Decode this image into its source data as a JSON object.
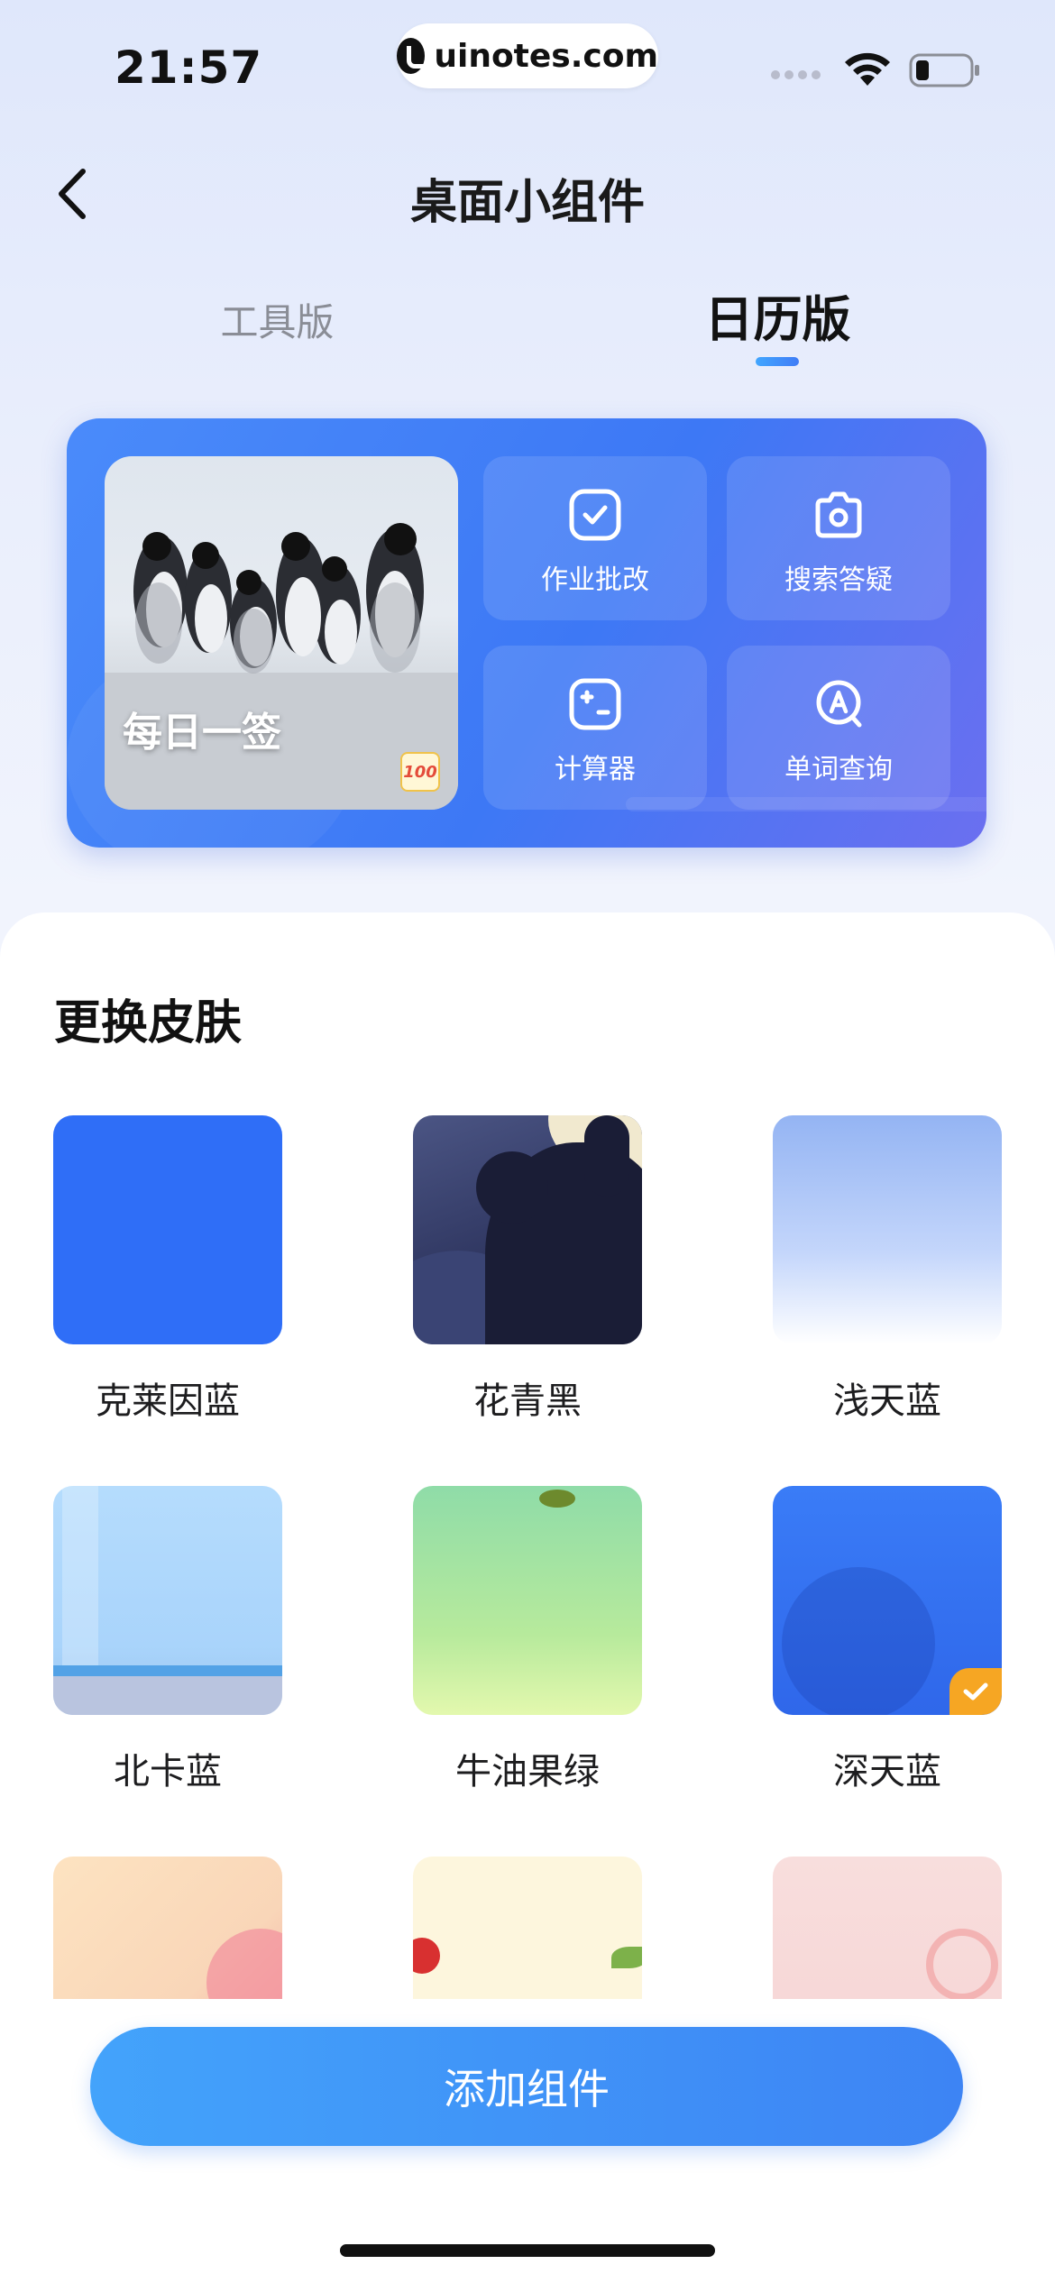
{
  "status_bar": {
    "time": "21:57",
    "url": "uinotes.com"
  },
  "nav": {
    "title": "桌面小组件"
  },
  "tabs": [
    {
      "label": "工具版",
      "active": false
    },
    {
      "label": "日历版",
      "active": true
    }
  ],
  "widget": {
    "daily_label": "每日一签",
    "badge": "100",
    "tools": [
      {
        "label": "作业批改",
        "icon": "homework-check-icon"
      },
      {
        "label": "搜索答疑",
        "icon": "camera-icon"
      },
      {
        "label": "计算器",
        "icon": "calculator-icon"
      },
      {
        "label": "单词查询",
        "icon": "word-search-icon"
      }
    ]
  },
  "skins_section": {
    "title": "更换皮肤",
    "items": [
      {
        "name": "克莱因蓝",
        "selected": false
      },
      {
        "name": "花青黑",
        "selected": false
      },
      {
        "name": "浅天蓝",
        "selected": false
      },
      {
        "name": "北卡蓝",
        "selected": false
      },
      {
        "name": "牛油果绿",
        "selected": false
      },
      {
        "name": "深天蓝",
        "selected": true
      },
      {
        "name": "",
        "selected": false
      },
      {
        "name": "",
        "selected": false
      },
      {
        "name": "",
        "selected": false
      }
    ]
  },
  "add_button": {
    "label": "添加组件"
  },
  "colors": {
    "accent": "#3d84f4",
    "selected_check": "#f6a623"
  }
}
